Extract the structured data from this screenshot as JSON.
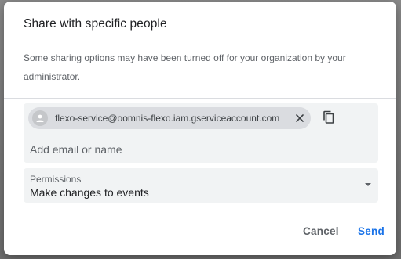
{
  "dialog": {
    "title": "Share with specific people",
    "notice": "Some sharing options may have been turned off for your organization by your administrator."
  },
  "recipients": {
    "chips": [
      {
        "email": "flexo-service@oomnis-flexo.iam.gserviceaccount.com",
        "avatar_icon": "person-icon",
        "remove_icon": "close-icon"
      }
    ],
    "copy_icon": "copy-icon",
    "input_placeholder": "Add email or name",
    "input_value": ""
  },
  "permissions": {
    "label": "Permissions",
    "selected": "Make changes to events",
    "dropdown_icon": "caret-down-icon"
  },
  "actions": {
    "cancel_label": "Cancel",
    "send_label": "Send"
  },
  "colors": {
    "accent": "#1a73e8",
    "field_background": "#f1f3f4",
    "chip_background": "#dadce0",
    "secondary_text": "#5f6368"
  }
}
